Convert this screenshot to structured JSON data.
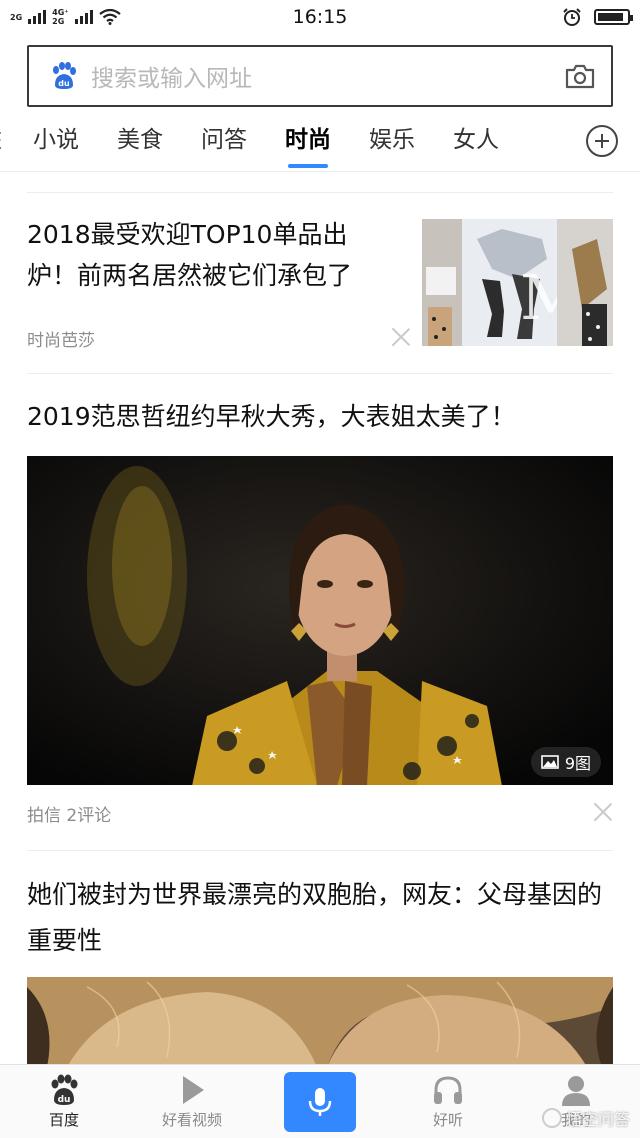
{
  "status_bar": {
    "sim1_net": "2G",
    "sim2_net_top": "4G⁺",
    "sim2_net_bottom": "2G",
    "time": "16:15"
  },
  "search": {
    "placeholder": "搜索或输入网址"
  },
  "tabs": {
    "partial": "E",
    "items": [
      "小说",
      "美食",
      "问答",
      "时尚",
      "娱乐",
      "女人"
    ],
    "active": "时尚"
  },
  "articles": [
    {
      "title": "2018最受欢迎TOP10单品出炉！前两名居然被它们承包了",
      "source": "时尚芭莎",
      "image": "fashion-collage-thumbnail"
    },
    {
      "title": "2019范思哲纽约早秋大秀，大表姐太美了！",
      "source": "拍信  2评论",
      "image": "runway-model-photo",
      "image_count": "9图"
    },
    {
      "title": "她们被封为世界最漂亮的双胞胎，网友：父母基因的重要性",
      "image": "twins-photo"
    }
  ],
  "bottom_nav": {
    "home": "百度",
    "video": "好看视频",
    "listen": "好听",
    "profile": "我的"
  },
  "watermark": "悟空问答",
  "colors": {
    "accent": "#3388ff",
    "text_primary": "#111111",
    "text_secondary": "#8c8c8c"
  }
}
